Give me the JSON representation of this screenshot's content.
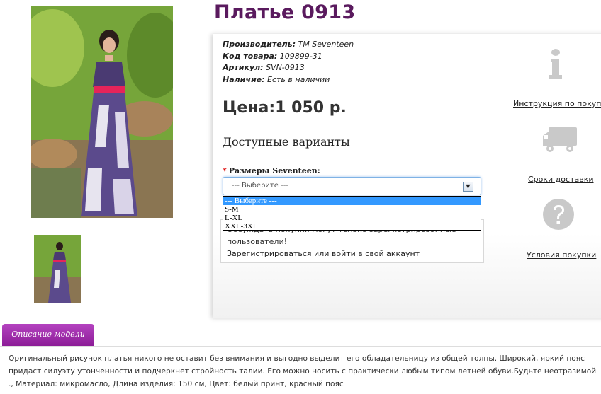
{
  "product": {
    "title": "Платье 0913",
    "manufacturer_label": "Производитель:",
    "manufacturer_value": "TM Seventeen",
    "code_label": "Код товара:",
    "code_value": "109899-31",
    "sku_label": "Артикул:",
    "sku_value": "SVN-0913",
    "availability_label": "Наличие:",
    "availability_value": "Есть в наличии",
    "price": "Цена:1 050 р."
  },
  "options": {
    "heading": "Доступные варианты",
    "required_mark": "*",
    "size_label": "Размеры Seventeen:",
    "selected_value": "--- Выберите ---",
    "dropdown_items": [
      "--- Выберите ---",
      "S-M",
      "L-XL",
      "XXL-3XL"
    ]
  },
  "notice": {
    "line1": "Обсуждать покупки могут только зарегистрированные",
    "line2": "пользователи!",
    "link": "Зарегистрироваться или войти в свой аккаунт"
  },
  "side_links": {
    "instructions": "Инструкция по покупке",
    "delivery": "Сроки доставки",
    "terms": "Условия покупки"
  },
  "icons": {
    "info": "info-icon",
    "truck": "truck-icon",
    "question": "question-icon",
    "dropdown_arrow": "chevron-down-icon"
  },
  "tabs": {
    "description_tab": "Описание модели"
  },
  "description": "Оригинальный рисунок платья никого не оставит без внимания и выгодно выделит его обладательницу из общей толпы. Широкий, яркий пояс придаст силуэту утонченности и подчеркнет стройность талии. Его можно носить с практически любым типом летней обуви.Будьте неотразимой ., Материал: микромасло, Длина изделия: 150 см, Цвет: белый принт, красный пояс",
  "colors": {
    "title": "#5a1a5e",
    "tab": "#9b2aa6",
    "dropdown_selected": "#3399ff",
    "required": "#dd0000"
  }
}
